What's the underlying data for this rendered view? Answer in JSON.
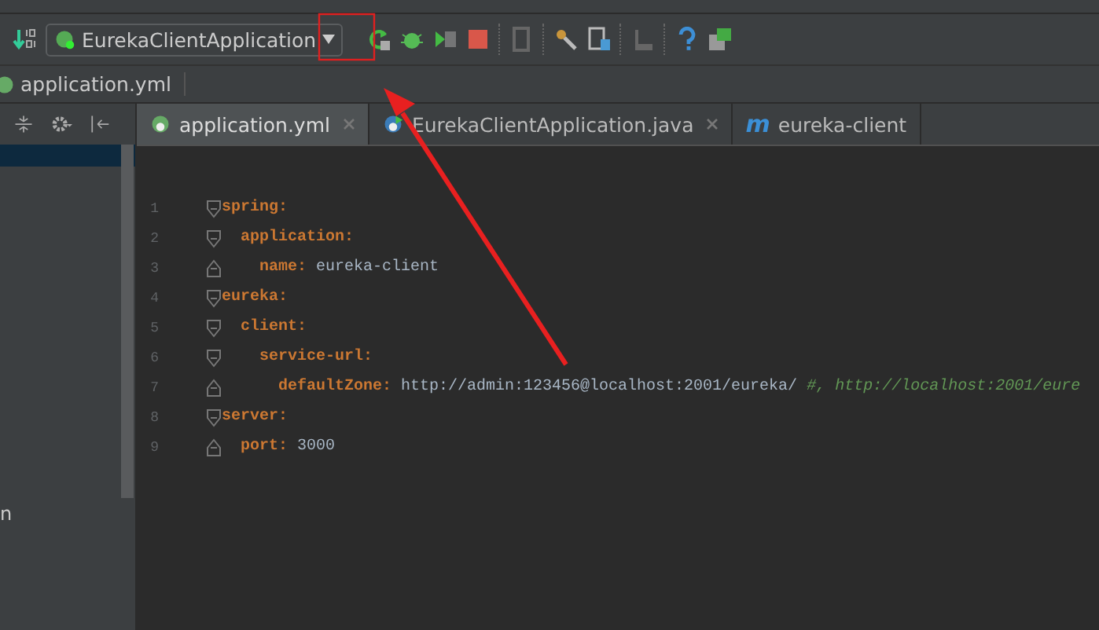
{
  "toolbar": {
    "run_config": "EurekaClientApplication"
  },
  "breadcrumb": "application.yml",
  "left_panel": {
    "partial_text": "n"
  },
  "tabs": [
    {
      "label": "application.yml",
      "kind": "spring",
      "selected": true,
      "closable": true
    },
    {
      "label": "EurekaClientApplication.java",
      "kind": "class",
      "selected": false,
      "closable": true
    },
    {
      "label": "eureka-client",
      "kind": "maven",
      "badge": "m",
      "selected": false,
      "closable": false
    }
  ],
  "code": [
    {
      "line": "1",
      "key": "spring:",
      "children": [
        {
          "line": "2",
          "key": "application:",
          "children": [
            {
              "line": "3",
              "key": "name:",
              "value": "eureka-client"
            }
          ]
        }
      ]
    },
    {
      "line": "4",
      "key": "eureka:",
      "children": [
        {
          "line": "5",
          "key": "client:",
          "children": [
            {
              "line": "6",
              "key": "service-url:",
              "children": [
                {
                  "line": "7",
                  "key": "defaultZone:",
                  "value": "http://admin:123456@localhost:2001/eureka/",
                  "comment": "#, http://localhost:2001/eure"
                }
              ]
            }
          ]
        }
      ]
    },
    {
      "line": "8",
      "key": "server:",
      "children": [
        {
          "line": "9",
          "key": "port:",
          "value": "3000"
        }
      ]
    }
  ]
}
